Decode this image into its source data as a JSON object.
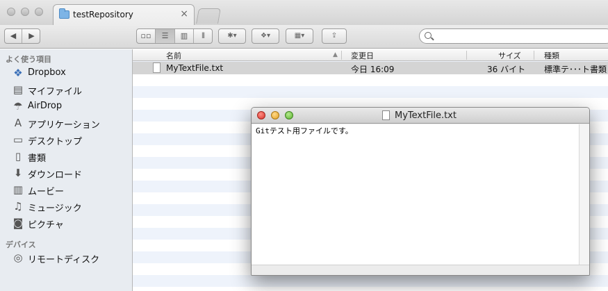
{
  "tab": {
    "title": "testRepository",
    "close_glyph": "×"
  },
  "toolbar": {
    "back_glyph": "◀",
    "forward_glyph": "▶",
    "view_icons": [
      "icon-view-icon",
      "list-view-icon",
      "column-view-icon",
      "coverflow-view-icon"
    ],
    "gear_glyph": "✱▾",
    "dropbox_glyph": "❖▾",
    "arrange_glyph": "▦▾",
    "share_glyph": "⇪",
    "search_placeholder": ""
  },
  "sidebar": {
    "favorites_heading": "よく使う項目",
    "favorites": [
      {
        "label": "Dropbox",
        "icon": "dropbox-icon",
        "glyph": "❖"
      },
      {
        "label": "マイファイル",
        "icon": "all-my-files-icon",
        "glyph": "▤"
      },
      {
        "label": "AirDrop",
        "icon": "airdrop-icon",
        "glyph": "☂"
      },
      {
        "label": "アプリケーション",
        "icon": "applications-icon",
        "glyph": "A"
      },
      {
        "label": "デスクトップ",
        "icon": "desktop-icon",
        "glyph": "▭"
      },
      {
        "label": "書類",
        "icon": "documents-icon",
        "glyph": "▯"
      },
      {
        "label": "ダウンロード",
        "icon": "downloads-icon",
        "glyph": "⬇"
      },
      {
        "label": "ムービー",
        "icon": "movies-icon",
        "glyph": "▥"
      },
      {
        "label": "ミュージック",
        "icon": "music-icon",
        "glyph": "♫"
      },
      {
        "label": "ピクチャ",
        "icon": "pictures-icon",
        "glyph": "◙"
      }
    ],
    "devices_heading": "デバイス",
    "devices": [
      {
        "label": "リモートディスク",
        "icon": "remote-disc-icon",
        "glyph": "◎"
      }
    ]
  },
  "list": {
    "columns": {
      "name": "名前",
      "modified": "変更日",
      "size": "サイズ",
      "kind": "種類"
    },
    "sort_indicator": "▲",
    "rows": [
      {
        "name": "MyTextFile.txt",
        "modified": "今日 16:09",
        "size": "36 バイト",
        "kind": "標準テ･･･ト書類"
      }
    ]
  },
  "doc_window": {
    "title": "MyTextFile.txt",
    "content": "Gitテスト用ファイルです。"
  }
}
